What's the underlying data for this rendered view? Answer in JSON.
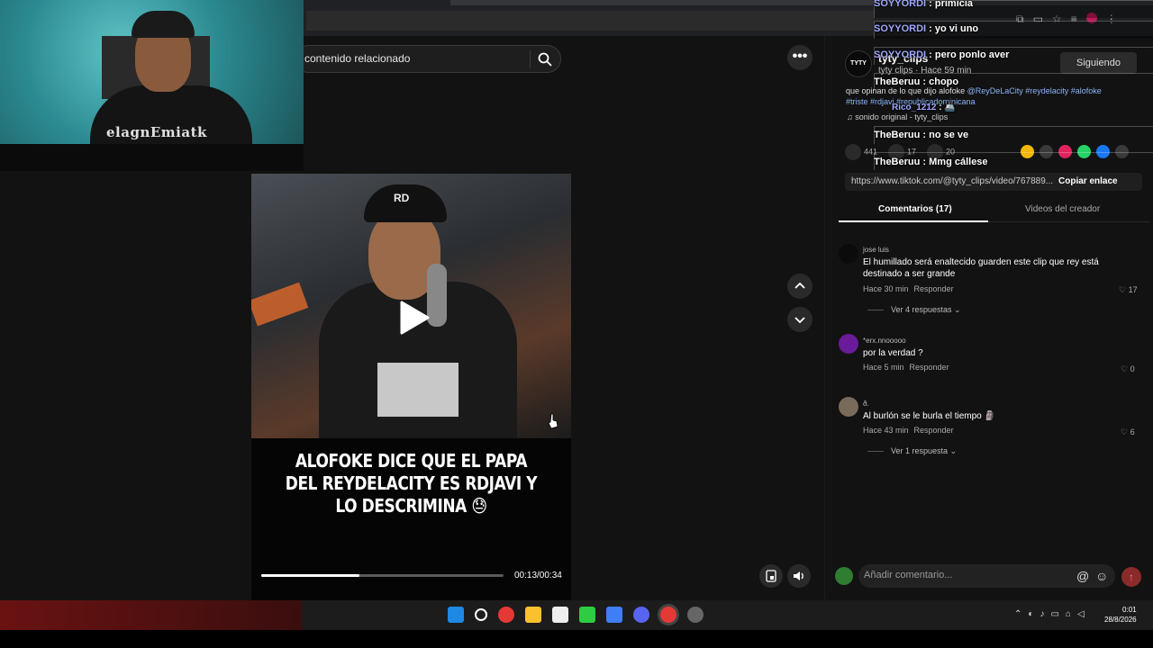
{
  "search": {
    "text": "contenido relacionado"
  },
  "webcam": {
    "hoodie_text": "elagnEmiatk"
  },
  "video": {
    "cap_text": "RD",
    "caption": "ALOFOKE DICE QUE EL PAPA DEL REYDELACITY ES RDJAVI Y LO DESCRIMINA 😓",
    "time": "00:13/00:34",
    "progress": 0.405
  },
  "creator": {
    "avatar_text": "TYTY",
    "name": "tyty_clips",
    "meta": "tyty clips · Hace 59 min",
    "follow_label": "Siguiendo",
    "description_plain": "que opinan de lo que dijo alofoke ",
    "description_tags_1": "@ReyDeLaCity #reydelacity #alofoke",
    "description_tags_2": "#triste #rdjavi #republicadominicana",
    "sound": "♫  sonido original - tyty_clips"
  },
  "stats": {
    "likes": "441",
    "comments": "17",
    "saves": "20"
  },
  "link": {
    "url": "https://www.tiktok.com/@tyty_clips/video/767889...",
    "copy_label": "Copiar enlace"
  },
  "tabs": {
    "comments": "Comentarios (17)",
    "videos": "Videos del creador"
  },
  "comments": [
    {
      "user": "jose luis",
      "text": "El humillado será enaltecido guarden este clip que rey está destinado a ser grande",
      "time": "Hace 30 min",
      "reply": "Responder",
      "likes": "17",
      "replies": "Ver 4 respuestas ⌄"
    },
    {
      "user": "*erx.nnooooo",
      "text": "por la verdad ?",
      "time": "Hace 5 min",
      "reply": "Responder",
      "likes": "0",
      "replies": ""
    },
    {
      "user": "ð.",
      "text": "Al burlón se le burla el tiempo 🗿",
      "time": "Hace 43 min",
      "reply": "Responder",
      "likes": "6",
      "replies": "Ver 1 respuesta ⌄"
    }
  ],
  "comment_input": {
    "placeholder": "Añadir comentario..."
  },
  "chat": [
    {
      "name": "SOYYORDI",
      "msg": ": primicia"
    },
    {
      "name": "SOYYORDI",
      "msg": ": yo vi uno"
    },
    {
      "name": "SOYYORDI",
      "msg": ": pero ponlo aver"
    },
    {
      "name": "TheBeruu",
      "msg": ": chopo"
    },
    {
      "name": "Rico_1212",
      "msg": ": 🚢"
    },
    {
      "name": "TheBeruu",
      "msg": ": no se ve"
    },
    {
      "name": "TheBeruu",
      "msg": ": Mmg cállese"
    }
  ],
  "clock": {
    "time": "0:01",
    "date": "28/8/2026"
  },
  "colors": {
    "accent": "#fe2c55",
    "tag": "#8ab4f8",
    "chat_name": "#9fa8ff"
  }
}
